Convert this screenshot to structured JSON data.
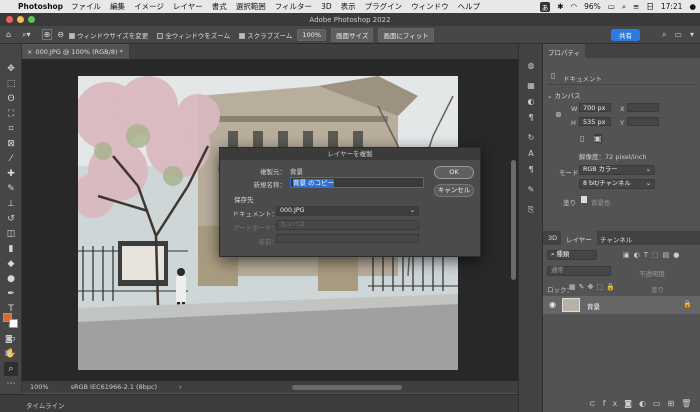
{
  "menubar": {
    "app": "Photoshop",
    "items": [
      "ファイル",
      "編集",
      "イメージ",
      "レイヤー",
      "書式",
      "選択範囲",
      "フィルター",
      "3D",
      "表示",
      "プラグイン",
      "ウィンドウ",
      "ヘルプ"
    ],
    "ime": "あ",
    "battery": "96%",
    "day": "日",
    "time": "17:21"
  },
  "window_title": "Adobe Photoshop 2022",
  "options_bar": {
    "resize_windows": "ウィンドウサイズを変更",
    "all_windows": "全ウィンドウをズーム",
    "scrubby_zoom": "スクラブズーム",
    "zoom_pct": "100%",
    "fit_screen_size": "画面サイズ",
    "fit_screen": "画面にフィット",
    "share": "共有"
  },
  "document_tab": "000.JPG @ 100% (RGB/8) *",
  "status_bar": {
    "zoom": "100%",
    "profile": "sRGB IEC61966-2.1 (8bpc)"
  },
  "timeline_label": "タイムライン",
  "dialog": {
    "title": "レイヤーを複製",
    "source_label": "複製元：",
    "source_value": "背景",
    "newname_label": "新規名称：",
    "newname_value": "背景 のコピー",
    "destination_label": "保存先",
    "document_label": "ドキュメント：",
    "document_value": "000.JPG",
    "artboard_label": "アートボード：",
    "artboard_value": "カンバス",
    "name_label": "名前：",
    "ok": "OK",
    "cancel": "キャンセル"
  },
  "properties": {
    "tab": "プロパティ",
    "doc_label": "ドキュメント",
    "canvas_heading": "カンバス",
    "w_label": "W",
    "w_value": "700 px",
    "h_label": "H",
    "h_value": "535 px",
    "x_label": "X",
    "y_label": "Y",
    "resolution": "解像度：72 pixel/inch",
    "mode_label": "モード",
    "mode_value": "RGB カラー",
    "depth_value": "8 bit/チャンネル",
    "fill_label": "塗り",
    "fill_value": "背景色"
  },
  "layers": {
    "tabs": [
      "3D",
      "レイヤー",
      "チャンネル"
    ],
    "kind": "種類",
    "blend": "通常",
    "opacity": "不透明度",
    "lock": "ロック：",
    "fill": "塗り",
    "layer_name": "背景"
  }
}
